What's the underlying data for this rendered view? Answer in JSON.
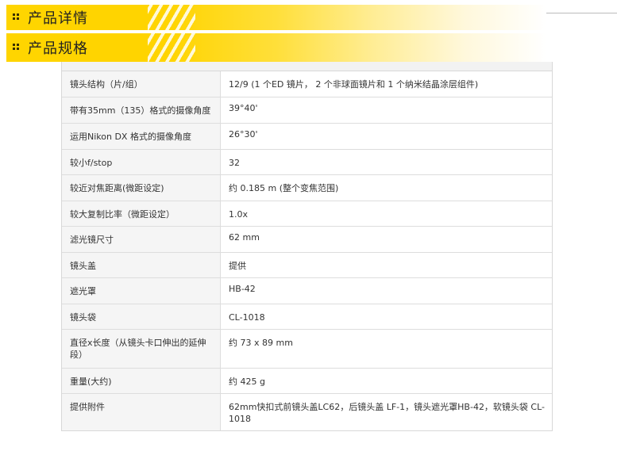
{
  "banners": [
    {
      "title": "产品详情"
    },
    {
      "title": "产品规格"
    }
  ],
  "specs": [
    {
      "label": "镜头结构（片/组）",
      "value": "12/9 (1 个ED 镜片， 2 个非球面镜片和 1 个纳米结晶涂层组件)"
    },
    {
      "label": "带有35mm（135）格式的摄像角度",
      "value": "39°40'"
    },
    {
      "label": "运用Nikon DX 格式的摄像角度",
      "value": "26°30'"
    },
    {
      "label": "较小f/stop",
      "value": "32"
    },
    {
      "label": "较近对焦距离(微距设定)",
      "value": "约 0.185 m (整个变焦范围)"
    },
    {
      "label": "较大复制比率（微距设定）",
      "value": "1.0x"
    },
    {
      "label": "滤光镜尺寸",
      "value": "62 mm"
    },
    {
      "label": "镜头盖",
      "value": "提供"
    },
    {
      "label": "遮光罩",
      "value": "HB-42"
    },
    {
      "label": "镜头袋",
      "value": "CL-1018"
    },
    {
      "label": "直径x长度（从镜头卡口伸出的延伸段）",
      "value": "约 73 x 89 mm"
    },
    {
      "label": "重量(大约)",
      "value": "约 425 g"
    },
    {
      "label": "提供附件",
      "value": "62mm快扣式前镜头盖LC62，后镜头盖 LF-1，镜头遮光罩HB-42，软镜头袋 CL-1018"
    }
  ]
}
